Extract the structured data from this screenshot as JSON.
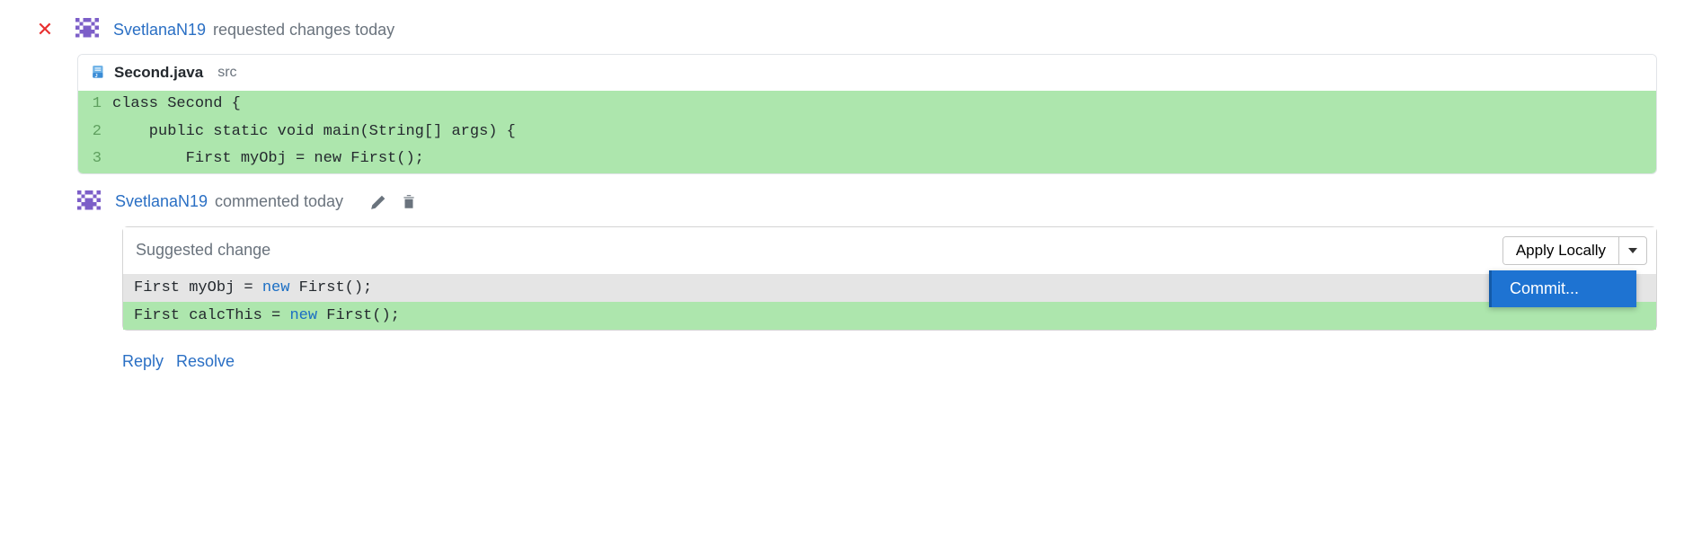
{
  "review": {
    "username": "SvetlanaN19",
    "action": "requested changes today"
  },
  "file": {
    "name": "Second.java",
    "path": "src",
    "lines": [
      {
        "num": "1",
        "content": "class Second {"
      },
      {
        "num": "2",
        "content": "    public static void main(String[] args) {"
      },
      {
        "num": "3",
        "content": "        First myObj = new First();"
      }
    ]
  },
  "comment": {
    "username": "SvetlanaN19",
    "action": "commented today"
  },
  "suggestion": {
    "label": "Suggested change",
    "apply_button": "Apply Locally",
    "diff_old_prefix": "First myObj = ",
    "diff_old_kw": "new",
    "diff_old_suffix": " First();",
    "diff_new_prefix": "First calcThis = ",
    "diff_new_kw": "new",
    "diff_new_suffix": " First();",
    "menu_item": "Commit..."
  },
  "actions": {
    "reply": "Reply",
    "resolve": "Resolve"
  }
}
